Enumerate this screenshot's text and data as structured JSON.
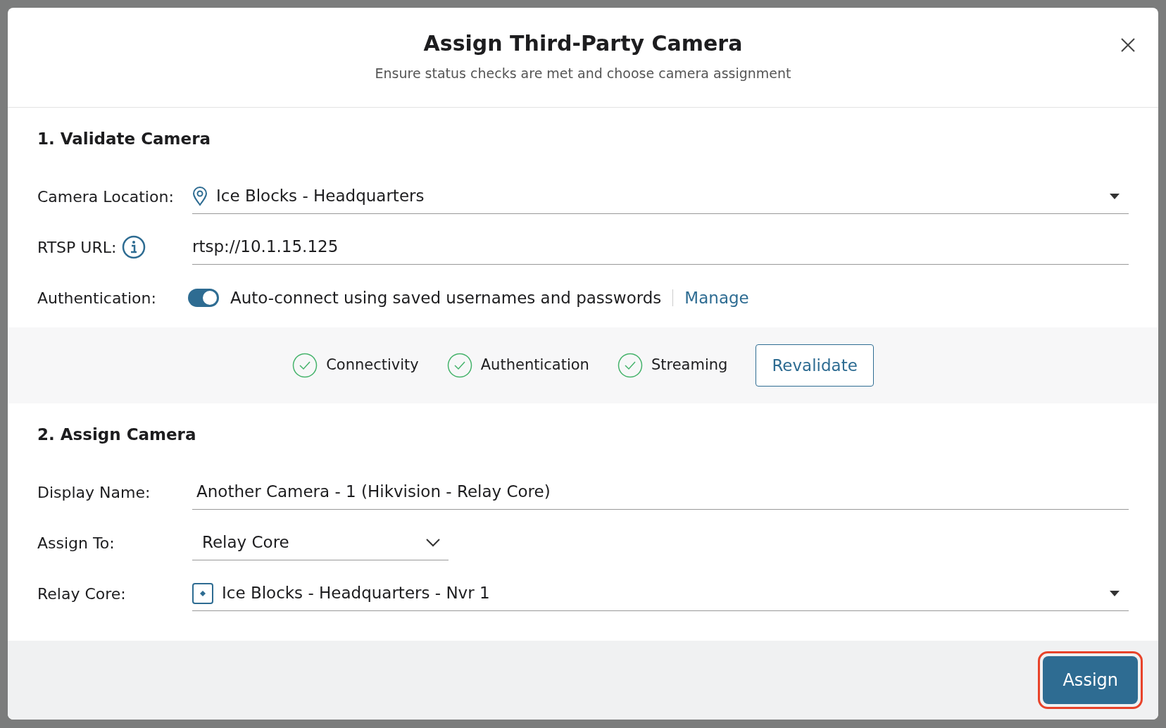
{
  "dialog": {
    "title": "Assign Third-Party Camera",
    "subtitle": "Ensure status checks are met and choose camera assignment"
  },
  "validate": {
    "title": "1. Validate Camera",
    "fields": [
      {
        "kind": "location-select",
        "label": "Camera Location:",
        "value": "Ice Blocks - Headquarters"
      },
      {
        "kind": "url",
        "label": "RTSP URL:",
        "value": "rtsp://10.1.15.125"
      },
      {
        "kind": "toggle",
        "label": "Authentication:",
        "on": true,
        "text": "Auto-connect using saved usernames and passwords",
        "link": "Manage"
      }
    ]
  },
  "checks": [
    {
      "label": "Connectivity",
      "passed": true
    },
    {
      "label": "Authentication",
      "passed": true
    },
    {
      "label": "Streaming",
      "passed": true
    }
  ],
  "revalidate_button": "Revalidate",
  "assign": {
    "title": "2. Assign Camera",
    "fields": [
      {
        "kind": "text",
        "label": "Display Name:",
        "value": "Another Camera - 1 (Hikvision - Relay Core)"
      },
      {
        "kind": "compact-select",
        "label": "Assign To:",
        "value": "Relay Core"
      },
      {
        "kind": "device-select",
        "label": "Relay Core:",
        "value": "Ice Blocks - Headquarters - Nvr 1"
      }
    ]
  },
  "footer": {
    "button": "Assign",
    "highlighted": true
  }
}
